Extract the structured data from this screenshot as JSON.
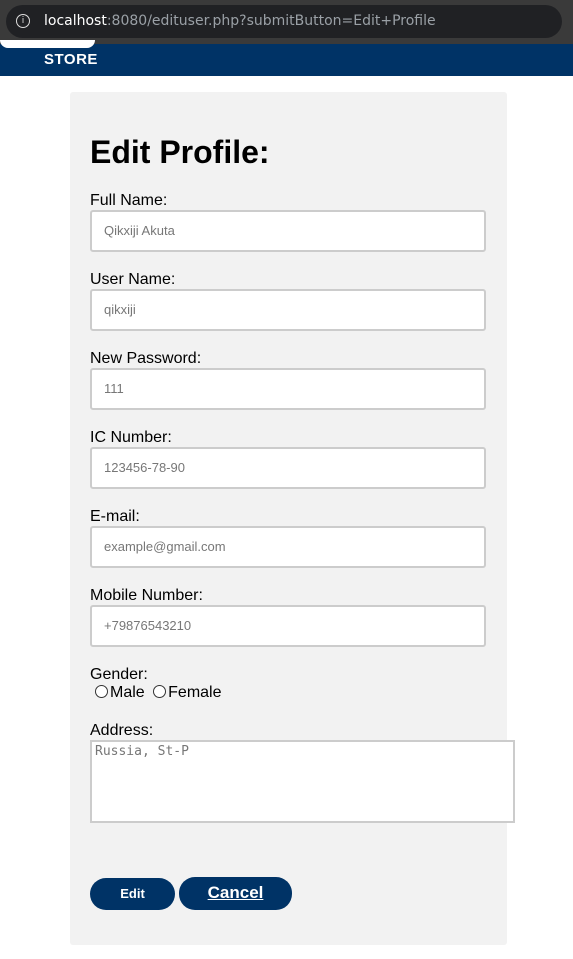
{
  "browser": {
    "url_host": "localhost",
    "url_rest": ":8080/edituser.php?submitButton=Edit+Profile"
  },
  "nav": {
    "logo_text": "STORE"
  },
  "form": {
    "title": "Edit Profile:",
    "fields": [
      {
        "label": "Full Name:",
        "placeholder": "Qikxiji Akuta"
      },
      {
        "label": "User Name:",
        "placeholder": "qikxiji"
      },
      {
        "label": "New Password:",
        "placeholder": "111"
      },
      {
        "label": "IC Number:",
        "placeholder": "123456-78-90"
      },
      {
        "label": "E-mail:",
        "placeholder": "example@gmail.com"
      },
      {
        "label": "Mobile Number:",
        "placeholder": "+79876543210"
      }
    ],
    "gender_label": "Gender:",
    "gender_options": [
      "Male",
      "Female"
    ],
    "address_label": "Address:",
    "address_placeholder": "Russia, St-P",
    "edit_label": "Edit",
    "cancel_label": "Cancel"
  }
}
